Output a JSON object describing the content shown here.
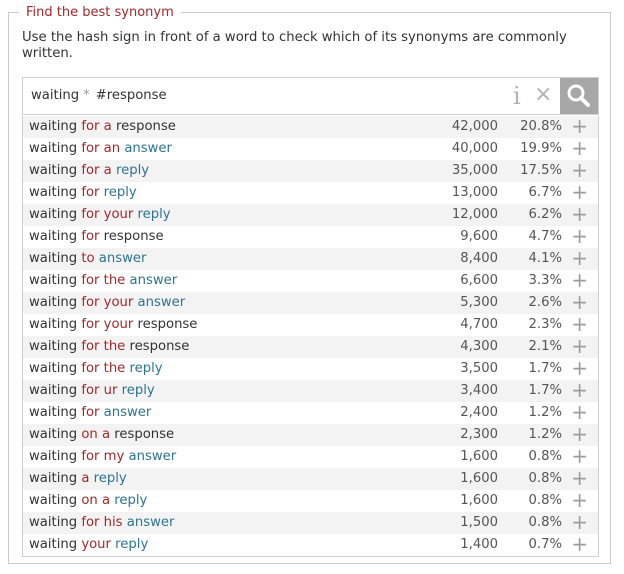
{
  "panel": {
    "title": "Find the best synonym",
    "description": "Use the hash sign in front of a word to check which of its synonyms are commonly written."
  },
  "search": {
    "word1": "waiting",
    "wildcard": "*",
    "word2": "#response",
    "info_glyph": "i",
    "clear_glyph": "×"
  },
  "icons": {
    "info": "info-icon",
    "clear": "close-icon",
    "search": "search-icon",
    "add": "plus-icon"
  },
  "colors": {
    "fixed_word": "#333333",
    "function_word": "#a3282b",
    "synonym_word": "#2d7491",
    "search_button": "#a7a7a7"
  },
  "results": [
    {
      "words": [
        [
          "waiting",
          0
        ],
        [
          "for",
          1
        ],
        [
          "a",
          1
        ],
        [
          "response",
          0
        ]
      ],
      "count": "42,000",
      "percent": "20.8%"
    },
    {
      "words": [
        [
          "waiting",
          0
        ],
        [
          "for",
          1
        ],
        [
          "an",
          1
        ],
        [
          "answer",
          2
        ]
      ],
      "count": "40,000",
      "percent": "19.9%"
    },
    {
      "words": [
        [
          "waiting",
          0
        ],
        [
          "for",
          1
        ],
        [
          "a",
          1
        ],
        [
          "reply",
          2
        ]
      ],
      "count": "35,000",
      "percent": "17.5%"
    },
    {
      "words": [
        [
          "waiting",
          0
        ],
        [
          "for",
          1
        ],
        [
          "reply",
          2
        ]
      ],
      "count": "13,000",
      "percent": "6.7%"
    },
    {
      "words": [
        [
          "waiting",
          0
        ],
        [
          "for",
          1
        ],
        [
          "your",
          1
        ],
        [
          "reply",
          2
        ]
      ],
      "count": "12,000",
      "percent": "6.2%"
    },
    {
      "words": [
        [
          "waiting",
          0
        ],
        [
          "for",
          1
        ],
        [
          "response",
          0
        ]
      ],
      "count": "9,600",
      "percent": "4.7%"
    },
    {
      "words": [
        [
          "waiting",
          0
        ],
        [
          "to",
          1
        ],
        [
          "answer",
          2
        ]
      ],
      "count": "8,400",
      "percent": "4.1%"
    },
    {
      "words": [
        [
          "waiting",
          0
        ],
        [
          "for",
          1
        ],
        [
          "the",
          1
        ],
        [
          "answer",
          2
        ]
      ],
      "count": "6,600",
      "percent": "3.3%"
    },
    {
      "words": [
        [
          "waiting",
          0
        ],
        [
          "for",
          1
        ],
        [
          "your",
          1
        ],
        [
          "answer",
          2
        ]
      ],
      "count": "5,300",
      "percent": "2.6%"
    },
    {
      "words": [
        [
          "waiting",
          0
        ],
        [
          "for",
          1
        ],
        [
          "your",
          1
        ],
        [
          "response",
          0
        ]
      ],
      "count": "4,700",
      "percent": "2.3%"
    },
    {
      "words": [
        [
          "waiting",
          0
        ],
        [
          "for",
          1
        ],
        [
          "the",
          1
        ],
        [
          "response",
          0
        ]
      ],
      "count": "4,300",
      "percent": "2.1%"
    },
    {
      "words": [
        [
          "waiting",
          0
        ],
        [
          "for",
          1
        ],
        [
          "the",
          1
        ],
        [
          "reply",
          2
        ]
      ],
      "count": "3,500",
      "percent": "1.7%"
    },
    {
      "words": [
        [
          "waiting",
          0
        ],
        [
          "for",
          1
        ],
        [
          "ur",
          1
        ],
        [
          "reply",
          2
        ]
      ],
      "count": "3,400",
      "percent": "1.7%"
    },
    {
      "words": [
        [
          "waiting",
          0
        ],
        [
          "for",
          1
        ],
        [
          "answer",
          2
        ]
      ],
      "count": "2,400",
      "percent": "1.2%"
    },
    {
      "words": [
        [
          "waiting",
          0
        ],
        [
          "on",
          1
        ],
        [
          "a",
          1
        ],
        [
          "response",
          0
        ]
      ],
      "count": "2,300",
      "percent": "1.2%"
    },
    {
      "words": [
        [
          "waiting",
          0
        ],
        [
          "for",
          1
        ],
        [
          "my",
          1
        ],
        [
          "answer",
          2
        ]
      ],
      "count": "1,600",
      "percent": "0.8%"
    },
    {
      "words": [
        [
          "waiting",
          0
        ],
        [
          "a",
          1
        ],
        [
          "reply",
          2
        ]
      ],
      "count": "1,600",
      "percent": "0.8%"
    },
    {
      "words": [
        [
          "waiting",
          0
        ],
        [
          "on",
          1
        ],
        [
          "a",
          1
        ],
        [
          "reply",
          2
        ]
      ],
      "count": "1,600",
      "percent": "0.8%"
    },
    {
      "words": [
        [
          "waiting",
          0
        ],
        [
          "for",
          1
        ],
        [
          "his",
          1
        ],
        [
          "answer",
          2
        ]
      ],
      "count": "1,500",
      "percent": "0.8%"
    },
    {
      "words": [
        [
          "waiting",
          0
        ],
        [
          "your",
          1
        ],
        [
          "reply",
          2
        ]
      ],
      "count": "1,400",
      "percent": "0.7%"
    }
  ]
}
